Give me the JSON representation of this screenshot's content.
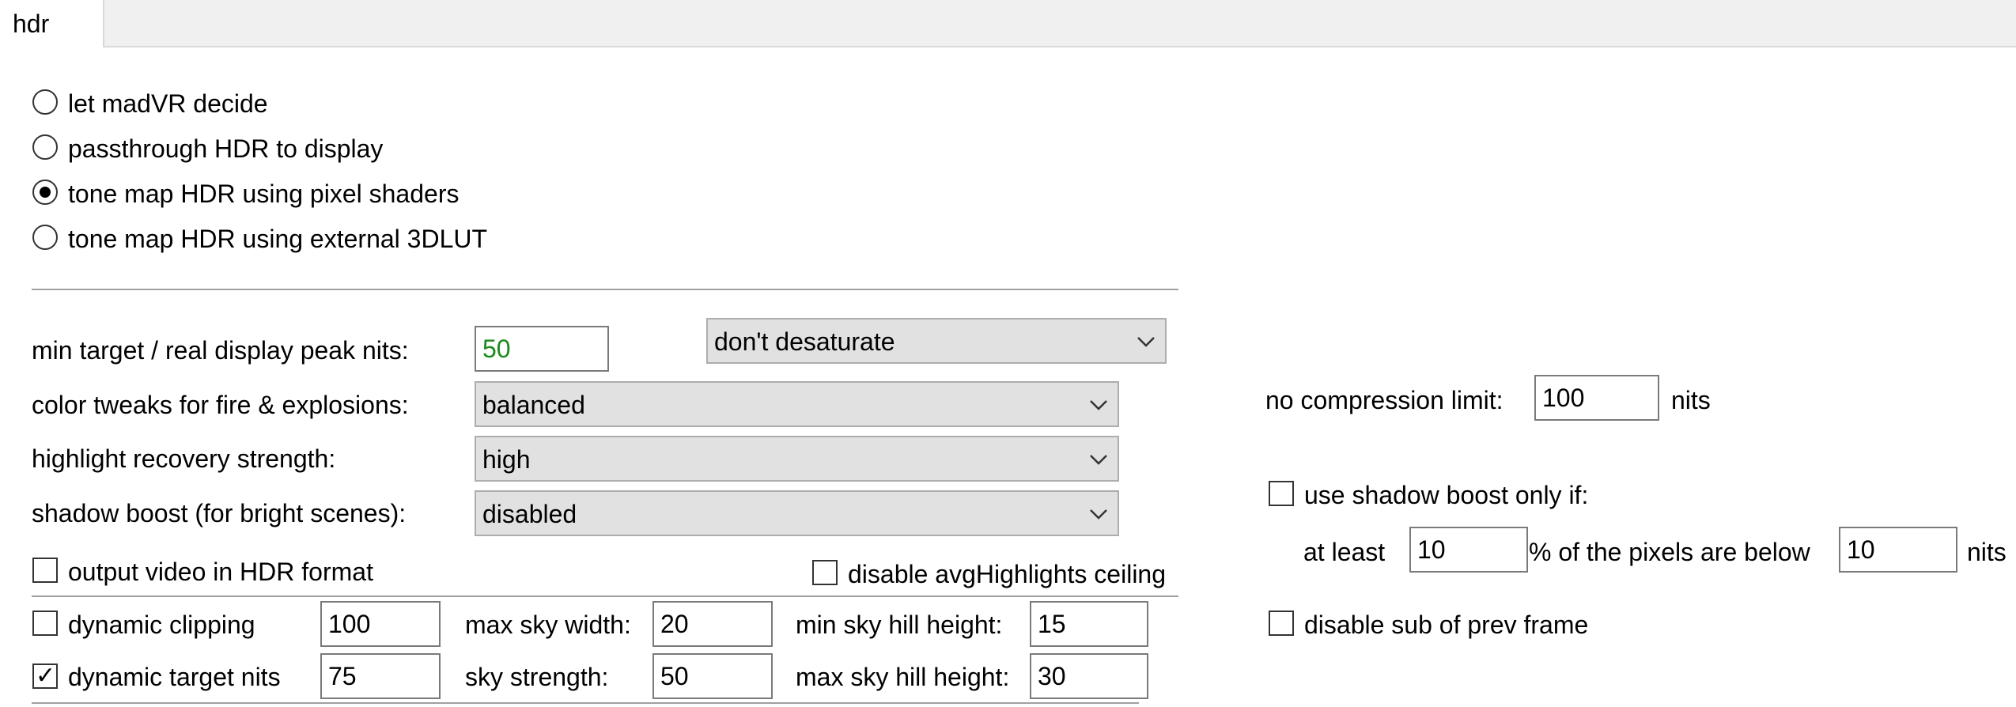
{
  "tab": {
    "label": "hdr"
  },
  "mode": {
    "options": [
      {
        "label": "let madVR decide",
        "selected": false
      },
      {
        "label": "passthrough HDR to display",
        "selected": false
      },
      {
        "label": "tone map HDR using pixel shaders",
        "selected": true
      },
      {
        "label": "tone map HDR using external 3DLUT",
        "selected": false
      }
    ]
  },
  "settings": {
    "peak_nits_label": "min target / real display peak nits:",
    "peak_nits_value": "50",
    "desaturate": "don't desaturate",
    "color_tweaks_label": "color tweaks for fire & explosions:",
    "color_tweaks_value": "balanced",
    "highlight_label": "highlight recovery strength:",
    "highlight_value": "high",
    "shadow_label": "shadow boost (for bright scenes):",
    "shadow_value": "disabled",
    "output_hdr_label": "output video in HDR format",
    "output_hdr_checked": false,
    "avg_highlights_label": "disable avgHighlights ceiling",
    "avg_highlights_checked": false
  },
  "dynamic": {
    "clipping_label": "dynamic clipping",
    "clipping_checked": false,
    "clipping_value": "100",
    "target_nits_label": "dynamic target nits",
    "target_nits_checked": true,
    "target_nits_value": "75",
    "max_sky_width_label": "max sky width:",
    "max_sky_width_value": "20",
    "sky_strength_label": "sky strength:",
    "sky_strength_value": "50",
    "min_sky_hill_label": "min sky hill height:",
    "min_sky_hill_value": "15",
    "max_sky_hill_label": "max sky hill height:",
    "max_sky_hill_value": "30"
  },
  "right": {
    "no_compression_label": "no compression limit:",
    "no_compression_value": "100",
    "nits_unit": "nits",
    "shadow_only_if_label": "use shadow boost only if:",
    "shadow_only_if_checked": false,
    "at_least_label": "at least",
    "at_least_value": "10",
    "pixels_below_label": "% of the pixels are below",
    "pixels_below_value": "10",
    "nits_unit_2": "nits",
    "disable_sub_label": "disable sub of prev frame",
    "disable_sub_checked": false
  },
  "colors": {
    "peak_nits_text": "#1a8a1a"
  }
}
